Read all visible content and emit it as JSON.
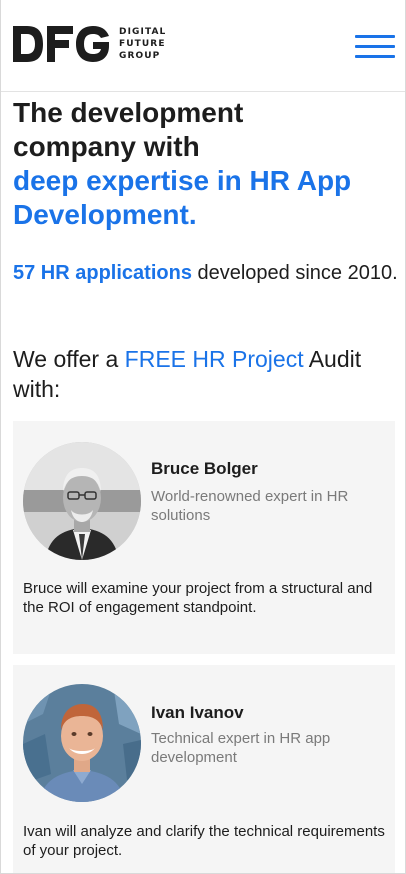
{
  "header": {
    "logo_letters": "DFG",
    "logo_lines": [
      "DIGITAL",
      "FUTURE",
      "GROUP"
    ],
    "menu_icon": "hamburger-menu-icon",
    "accent_color": "#1a73e8"
  },
  "hero": {
    "title_line1": "The development",
    "title_line2": "company with",
    "title_accent1": "deep expertise in HR App",
    "title_accent2": "Development."
  },
  "stat": {
    "accent": "57 HR applications",
    "rest": " developed since 2010."
  },
  "offer": {
    "prefix": "We offer a ",
    "accent": "FREE HR Project",
    "suffix": " Audit with:"
  },
  "experts": [
    {
      "name": "Bruce Bolger",
      "role": "World-renowned expert in HR solutions",
      "description": "Bruce will examine your project from a structural and the ROI of engagement standpoint."
    },
    {
      "name": "Ivan Ivanov",
      "role": "Technical expert in HR app development",
      "description": "Ivan will analyze and clarify the technical requirements of your project."
    }
  ]
}
